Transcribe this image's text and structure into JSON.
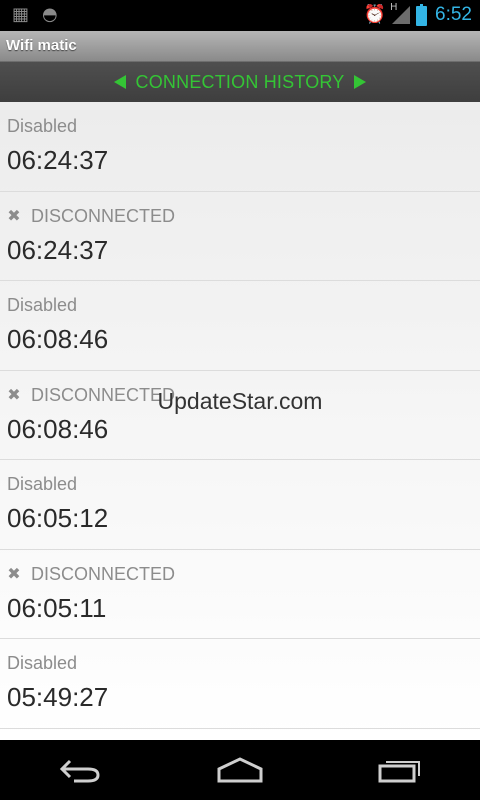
{
  "status_bar": {
    "time": "6:52",
    "signal_label": "H"
  },
  "app": {
    "title": "Wifi matic"
  },
  "history_header": {
    "title": "CONNECTION HISTORY"
  },
  "items": [
    {
      "status": "Disabled",
      "time": "06:24:37",
      "icon": ""
    },
    {
      "status": "DISCONNECTED",
      "time": "06:24:37",
      "icon": "close-icon"
    },
    {
      "status": "Disabled",
      "time": "06:08:46",
      "icon": ""
    },
    {
      "status": "DISCONNECTED",
      "time": "06:08:46",
      "icon": "close-icon"
    },
    {
      "status": "Disabled",
      "time": "06:05:12",
      "icon": ""
    },
    {
      "status": "DISCONNECTED",
      "time": "06:05:11",
      "icon": "close-icon"
    },
    {
      "status": "Disabled",
      "time": "05:49:27",
      "icon": ""
    }
  ],
  "watermark": "UpdateStar.com",
  "colors": {
    "accent_green": "#34c535",
    "status_blue": "#33b5e5"
  }
}
